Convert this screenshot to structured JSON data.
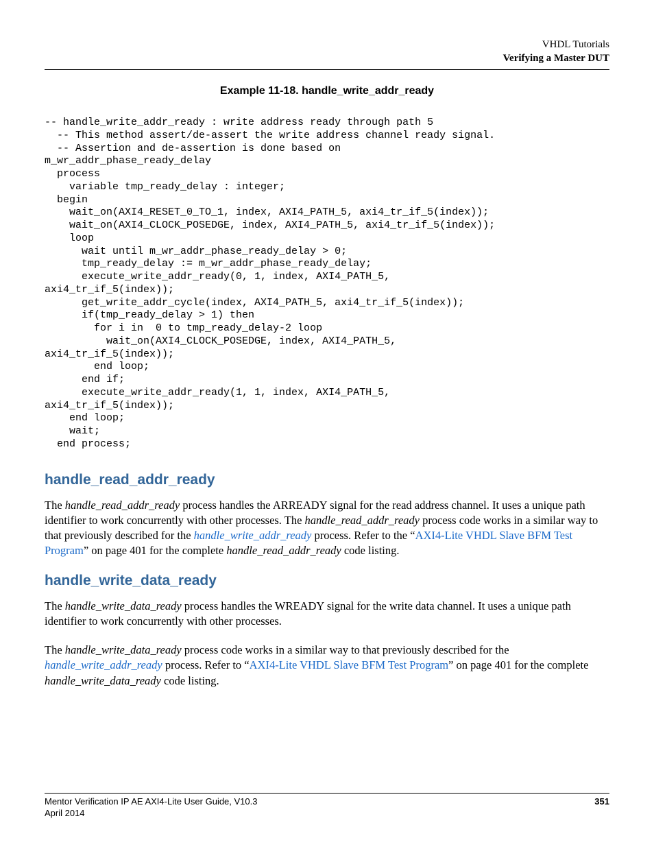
{
  "header": {
    "line1": "VHDL Tutorials",
    "line2": "Verifying a Master DUT"
  },
  "example_title": "Example 11-18. handle_write_addr_ready",
  "code": "-- handle_write_addr_ready : write address ready through path 5\n  -- This method assert/de-assert the write address channel ready signal.\n  -- Assertion and de-assertion is done based on\nm_wr_addr_phase_ready_delay\n  process\n    variable tmp_ready_delay : integer;\n  begin\n    wait_on(AXI4_RESET_0_TO_1, index, AXI4_PATH_5, axi4_tr_if_5(index));\n    wait_on(AXI4_CLOCK_POSEDGE, index, AXI4_PATH_5, axi4_tr_if_5(index));\n    loop\n      wait until m_wr_addr_phase_ready_delay > 0;\n      tmp_ready_delay := m_wr_addr_phase_ready_delay;\n      execute_write_addr_ready(0, 1, index, AXI4_PATH_5,\naxi4_tr_if_5(index));\n      get_write_addr_cycle(index, AXI4_PATH_5, axi4_tr_if_5(index));\n      if(tmp_ready_delay > 1) then\n        for i in  0 to tmp_ready_delay-2 loop\n          wait_on(AXI4_CLOCK_POSEDGE, index, AXI4_PATH_5,\naxi4_tr_if_5(index));\n        end loop;\n      end if;\n      execute_write_addr_ready(1, 1, index, AXI4_PATH_5,\naxi4_tr_if_5(index));\n    end loop;\n    wait;\n  end process;",
  "section1": {
    "heading": "handle_read_addr_ready",
    "p1a": "The ",
    "p1b": "handle_read_addr_ready",
    "p1c": " process handles the ARREADY signal for the read address channel. It uses a unique path identifier to work concurrently with other processes. The ",
    "p1d": "handle_read_addr_ready",
    "p1e": " process code works in a similar way to that previously described for the ",
    "p1f": "handle_write_addr_ready",
    "p1g": " process. Refer to the “",
    "p1h": "AXI4-Lite VHDL Slave BFM Test Program",
    "p1i": "” on page 401 for the complete ",
    "p1j": "handle_read_addr_ready",
    "p1k": " code listing."
  },
  "section2": {
    "heading": "handle_write_data_ready",
    "p1a": "The ",
    "p1b": "handle_write_data_ready",
    "p1c": " process handles the WREADY signal for the write data channel. It uses a unique path identifier to work concurrently with other processes.",
    "p2a": "The ",
    "p2b": "handle_write_data_ready",
    "p2c": " process code works in a similar way to that previously described for the ",
    "p2d": "handle_write_addr_ready",
    "p2e": " process. Refer to “",
    "p2f": "AXI4-Lite VHDL Slave BFM Test Program",
    "p2g": "” on page 401 for the complete ",
    "p2h": "handle_write_data_ready",
    "p2i": " code listing."
  },
  "footer": {
    "title": "Mentor Verification IP AE AXI4-Lite User Guide, V10.3",
    "date": "April 2014",
    "page": "351"
  }
}
